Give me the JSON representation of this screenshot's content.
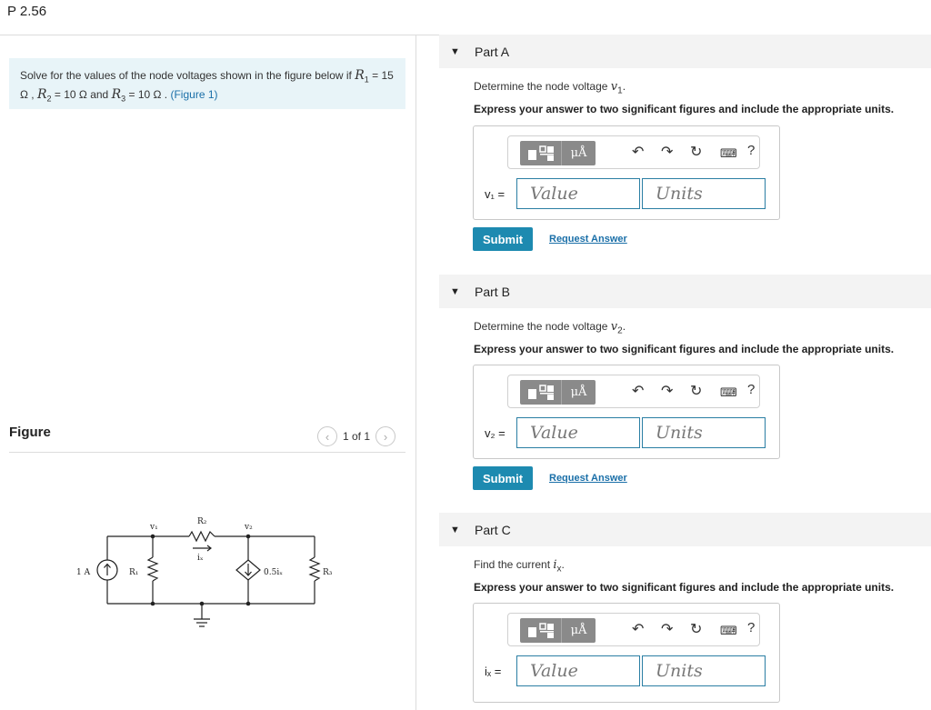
{
  "problem_id": "P 2.56",
  "problem": {
    "text_intro": "Solve for the values of the node voltages shown in the figure below if",
    "r1_sym": "R",
    "r1_sub": "1",
    "r1_val": " = 15 Ω , ",
    "r2_sym": "R",
    "r2_sub": "2",
    "r2_val": " = 10 Ω and ",
    "r3_sym": "R",
    "r3_sub": "3",
    "r3_val": " = 10 Ω . ",
    "figure_link": "(Figure 1)"
  },
  "figure": {
    "label": "Figure",
    "pager_text": "1 of 1",
    "prev_icon": "chevron-left-icon",
    "next_icon": "chevron-right-icon"
  },
  "circuit_labels": {
    "source": "1 A",
    "r1": "R₁",
    "r2": "R₂",
    "r3": "R₃",
    "v1": "v₁",
    "v2": "v₂",
    "ix": "iₓ",
    "dep": "0.5iₓ"
  },
  "toolbar": {
    "units_glyph": "μÅ",
    "help": "?",
    "icons": [
      "templates-icon",
      "units-icon",
      "undo-icon",
      "redo-icon",
      "reset-icon",
      "keyboard-icon",
      "help-icon"
    ]
  },
  "parts": [
    {
      "title": "Part A",
      "question": "Determine the node voltage ",
      "var": "v",
      "var_sub": "1",
      "express": "Express your answer to two significant figures and include the appropriate units.",
      "label": "v₁ =",
      "value_placeholder": "Value",
      "units_placeholder": "Units",
      "submit": "Submit",
      "request": "Request Answer"
    },
    {
      "title": "Part B",
      "question": "Determine the node voltage ",
      "var": "v",
      "var_sub": "2",
      "express": "Express your answer to two significant figures and include the appropriate units.",
      "label": "v₂ =",
      "value_placeholder": "Value",
      "units_placeholder": "Units",
      "submit": "Submit",
      "request": "Request Answer"
    },
    {
      "title": "Part C",
      "question": "Find the current ",
      "var": "i",
      "var_sub": "x",
      "express": "Express your answer to two significant figures and include the appropriate units.",
      "label": "iₓ =",
      "value_placeholder": "Value",
      "units_placeholder": "Units"
    }
  ]
}
